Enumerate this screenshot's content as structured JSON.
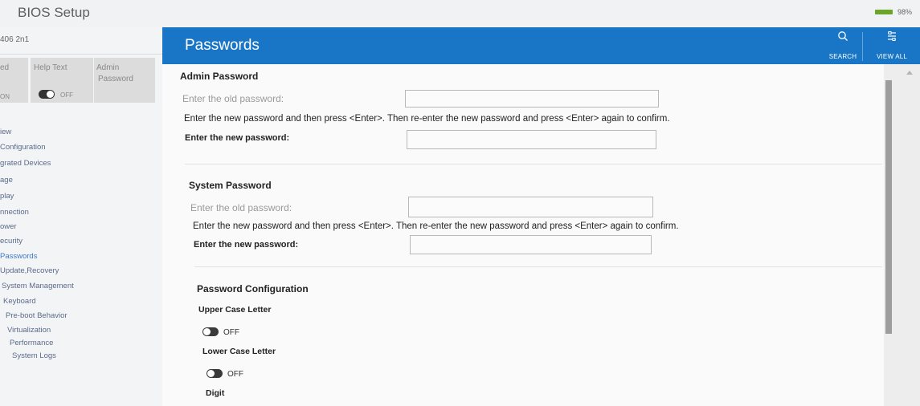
{
  "app": {
    "title": "BIOS Setup",
    "battery": "98%"
  },
  "sidebar": {
    "model": "406 2n1",
    "help_text_label": "Help Text",
    "help_text_toggle": "OFF",
    "help_left_toggle": "ON",
    "admin_label_line1": "Admin",
    "admin_label_line2": "Password",
    "left_cut_label": "ed",
    "nav": [
      "iew",
      "Configuration",
      "grated Devices",
      "age",
      "play",
      "nnection",
      "ower",
      "ecurity",
      "Passwords",
      "Update,Recovery",
      "System Management",
      "Keyboard",
      "Pre-boot Behavior",
      "Virtualization",
      "Performance",
      "System Logs"
    ]
  },
  "header": {
    "title": "Passwords",
    "search_label": "SEARCH",
    "view_all_label": "VIEW ALL"
  },
  "admin": {
    "title": "Admin Password",
    "old_placeholder": "Enter the old password:",
    "info": "Enter the new password and then press <Enter>. Then re-enter the new password and press <Enter> again to confirm.",
    "new_label": "Enter the new password:"
  },
  "system": {
    "title": "System Password",
    "old_placeholder": "Enter the old password:",
    "info": "Enter the new password and then press <Enter>. Then re-enter the new password and press <Enter> again to confirm.",
    "new_label": "Enter the new password:"
  },
  "config": {
    "title": "Password Configuration",
    "upper_label": "Upper Case Letter",
    "upper_state": "OFF",
    "lower_label": "Lower Case Letter",
    "lower_state": "OFF",
    "digit_label": "Digit"
  }
}
